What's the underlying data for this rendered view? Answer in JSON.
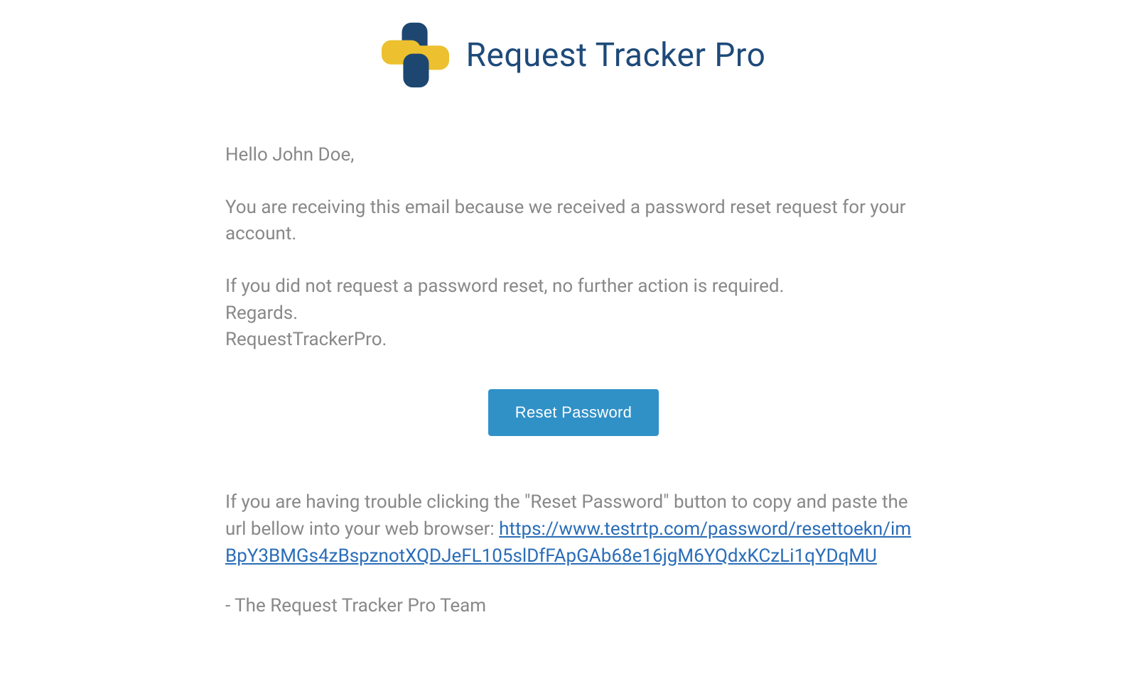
{
  "header": {
    "title": "Request Tracker Pro"
  },
  "body": {
    "greeting": "Hello John Doe,",
    "reason": "You are receiving this email because we received a password reset request for your account.",
    "no_action": "If you did not request a password reset, no further action is required.",
    "regards": "Regards.",
    "sender_name": "RequestTrackerPro.",
    "button_label": "Reset Password",
    "trouble_text": "If you are having trouble clicking the \"Reset Password\" button to copy and paste the url bellow into your web browser: ",
    "reset_url": "https://www.testrtp.com/password/resettoekn/imBpY3BMGs4zBspznotXQDJeFL105slDfFApGAb68e16jgM6YQdxKCzLi1qYDqMU",
    "signature": "- The Request Tracker Pro Team"
  },
  "colors": {
    "title_blue": "#1e4a7a",
    "button_blue": "#3091c7",
    "link_blue": "#2a6db8",
    "text_gray": "#888888",
    "logo_yellow": "#ecc02f",
    "logo_navy": "#1d4771"
  }
}
